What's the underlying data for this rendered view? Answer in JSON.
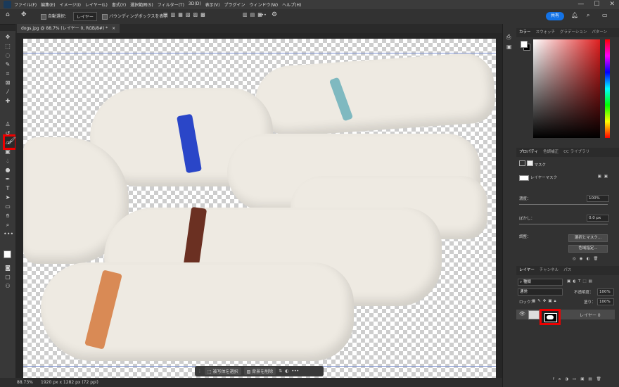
{
  "menubar": {
    "items": [
      "ファイル(F)",
      "編集(E)",
      "イメージ(I)",
      "レイヤー(L)",
      "書式(Y)",
      "選択範囲(S)",
      "フィルター(T)",
      "3D(D)",
      "表示(V)",
      "プラグイン",
      "ウィンドウ(W)",
      "ヘルプ(H)"
    ],
    "window_controls": [
      "—",
      "☐",
      "✕"
    ]
  },
  "options_bar": {
    "auto_select_label": "自動選択：",
    "auto_select_target": "レイヤー",
    "bounding_box_label": "バウンディングボックスを表示",
    "more": "•••",
    "share_label": "共有"
  },
  "document": {
    "tab_label": "dogs.jpg @ 88.7% (レイヤー 0, RGB/8#) *",
    "close": "×"
  },
  "status": {
    "zoom": "88.73%",
    "info": "1920 px x 1282 px (72 ppi)"
  },
  "context_bar": {
    "select_subject": "被写体を選択",
    "remove_background": "背景を削除",
    "more": "•••"
  },
  "color_panel": {
    "tabs": [
      "カラー",
      "スウォッチ",
      "グラデーション",
      "パターン"
    ]
  },
  "properties_panel": {
    "tabs": [
      "プロパティ",
      "色調補正",
      "CC ライブラリ"
    ],
    "mask_heading": "マスク",
    "layer_mask_label": "レイヤーマスク",
    "density_label": "濃度：",
    "density_value": "100%",
    "feather_label": "ぼかし：",
    "feather_value": "0.0 px",
    "adjust_label": "調整：",
    "select_mask_button": "選択とマスク...",
    "color_range_button": "色域指定..."
  },
  "layers_panel": {
    "tabs": [
      "レイヤー",
      "チャンネル",
      "パス"
    ],
    "filter_kind": "種類",
    "blend_mode": "通常",
    "opacity_label": "不透明度：",
    "opacity_value": "100%",
    "lock_label": "ロック：",
    "fill_label": "塗り：",
    "fill_value": "100%",
    "layer_name": "レイヤー 0",
    "footer_link": "fx"
  },
  "tools": [
    "move-tool",
    "artboard-tool",
    "marquee-tool",
    "lasso-tool",
    "quick-select-tool",
    "crop-tool",
    "frame-tool",
    "eyedropper-tool",
    "healing-brush-tool",
    "brush-tool",
    "clone-stamp-tool",
    "history-brush-tool",
    "eraser-tool",
    "gradient-tool",
    "blur-tool",
    "dodge-tool",
    "pen-tool",
    "type-tool",
    "path-select-tool",
    "rectangle-tool",
    "hand-tool",
    "zoom-tool",
    "more-tools",
    "swap-colors",
    "default-colors",
    "foreground-color",
    "background-color",
    "quick-mask",
    "screen-mode"
  ],
  "colors": {
    "accent": "#1473e6",
    "highlight": "#ee0000",
    "collar_blue": "#2a46c8",
    "collar_teal": "#7fb9c0",
    "collar_brown": "#6b3022",
    "collar_orange": "#d98a55"
  }
}
